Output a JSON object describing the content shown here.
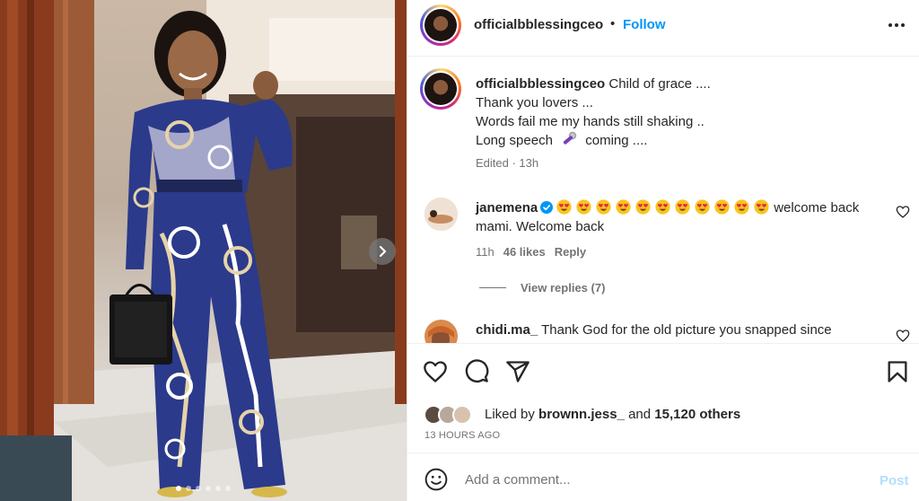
{
  "post": {
    "author": "officialbblessingceo",
    "separator": "•",
    "follow_label": "Follow",
    "more_icon": "more-horizontal-icon",
    "carousel_next_icon": "chevron-right-icon",
    "carousel": {
      "total": 6,
      "active_index": 0
    }
  },
  "caption": {
    "username": "officialbblessingceo",
    "lines": [
      "Child of grace ....",
      "Thank you lovers ...",
      "Words fail me my hands still shaking ..",
      "Long speech",
      "coming ...."
    ],
    "mic_icon": "microphone-emoji",
    "edited": "Edited · 13h"
  },
  "comments": [
    {
      "username": "janemena",
      "verified": true,
      "emoji_count": 11,
      "emoji_icon": "heart-eyes-emoji",
      "text_after": "welcome back",
      "text_line2": "mami. Welcome back",
      "time": "11h",
      "likes": "46 likes",
      "reply": "Reply",
      "view_replies": "View replies (7)"
    },
    {
      "username": "chidi.ma_",
      "text": "Thank God for the old picture you snapped since"
    }
  ],
  "actions": {
    "like_icon": "heart-icon",
    "comment_icon": "comment-icon",
    "share_icon": "send-icon",
    "save_icon": "bookmark-icon"
  },
  "likes": {
    "prefix": "Liked by",
    "by_user": "brownn.jess_",
    "middle": "and",
    "count": "15,120 others"
  },
  "time_ago": "13 HOURS AGO",
  "add_comment": {
    "placeholder": "Add a comment...",
    "post_label": "Post"
  },
  "colors": {
    "accent": "#0095f6",
    "post_disabled": "#b2dffc",
    "muted": "#737373",
    "text": "#262626"
  }
}
